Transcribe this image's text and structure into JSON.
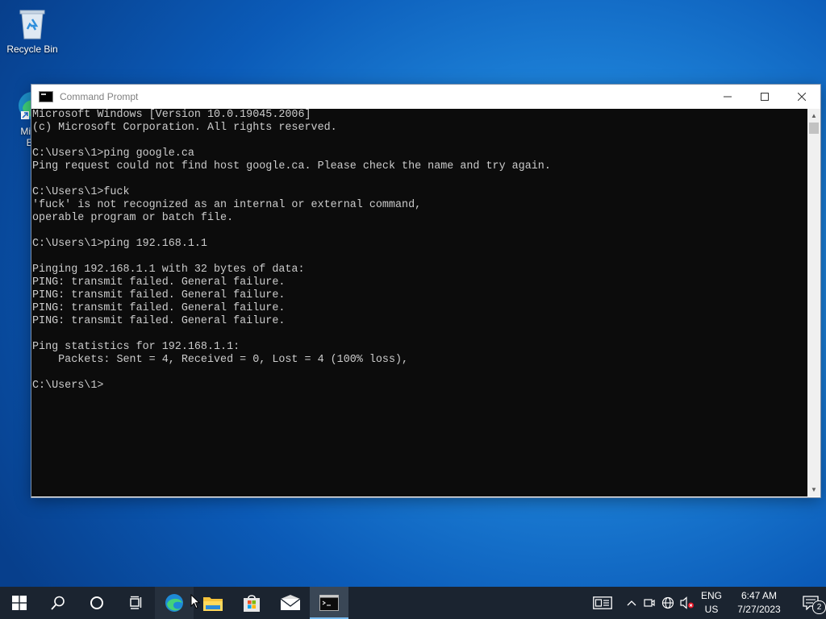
{
  "desktop": {
    "recycle_bin_label": "Recycle Bin",
    "edge_label_line1": "Micro",
    "edge_label_line2": "Ed"
  },
  "window": {
    "title": "Command Prompt",
    "console_lines": [
      "Microsoft Windows [Version 10.0.19045.2006]",
      "(c) Microsoft Corporation. All rights reserved.",
      "",
      "C:\\Users\\1>ping google.ca",
      "Ping request could not find host google.ca. Please check the name and try again.",
      "",
      "C:\\Users\\1>fuck",
      "'fuck' is not recognized as an internal or external command,",
      "operable program or batch file.",
      "",
      "C:\\Users\\1>ping 192.168.1.1",
      "",
      "Pinging 192.168.1.1 with 32 bytes of data:",
      "PING: transmit failed. General failure.",
      "PING: transmit failed. General failure.",
      "PING: transmit failed. General failure.",
      "PING: transmit failed. General failure.",
      "",
      "Ping statistics for 192.168.1.1:",
      "    Packets: Sent = 4, Received = 0, Lost = 4 (100% loss),",
      "",
      "C:\\Users\\1>"
    ]
  },
  "taskbar": {
    "lang_top": "ENG",
    "lang_bottom": "US",
    "time": "6:47 AM",
    "date": "7/27/2023",
    "notification_count": "2"
  },
  "colors": {
    "console_bg": "#0c0c0c",
    "console_text": "#cccccc",
    "taskbar_bg": "#1b2430",
    "accent": "#76b9ed"
  }
}
